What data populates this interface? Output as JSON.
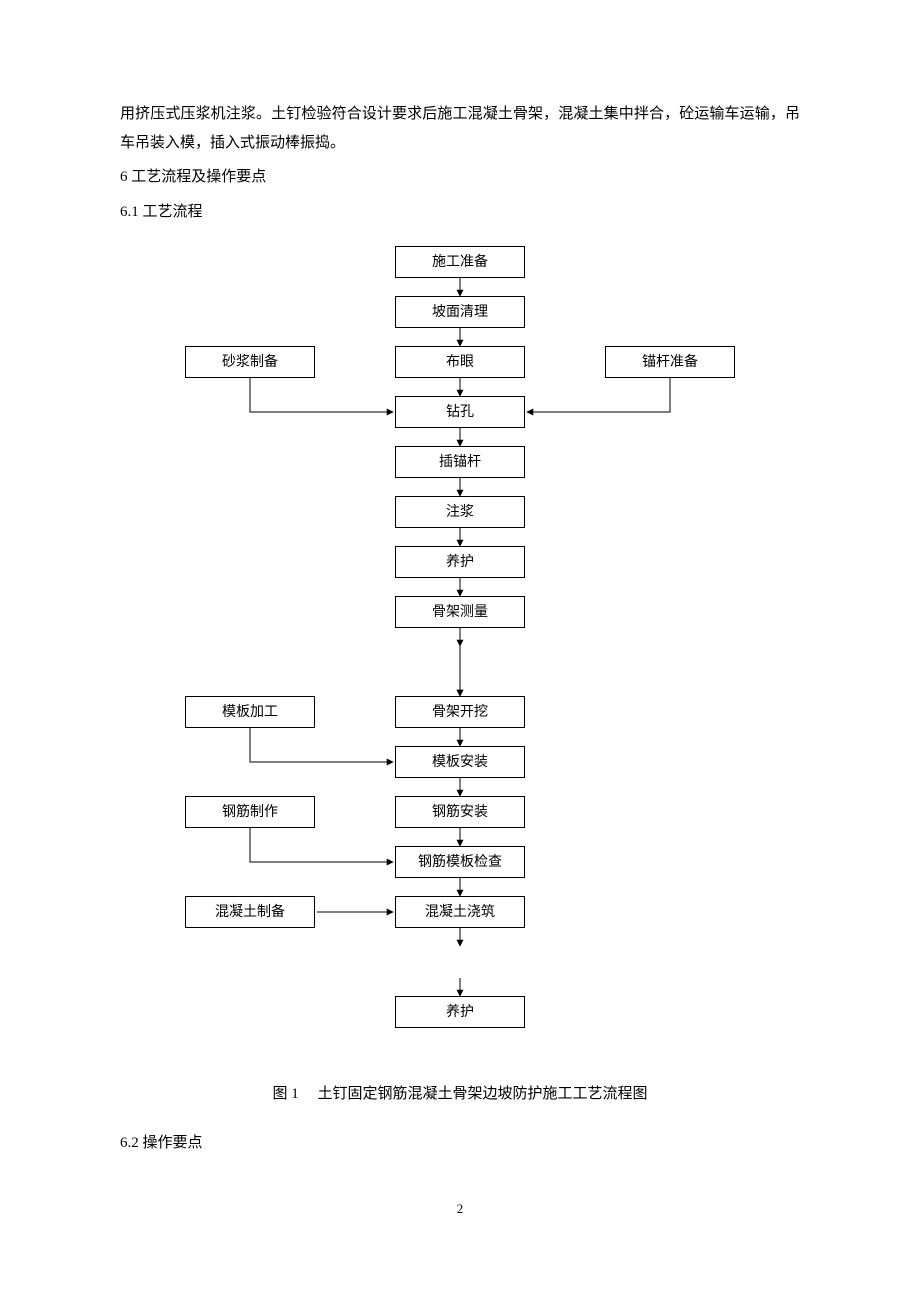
{
  "paragraph": "用挤压式压浆机注浆。土钉检验符合设计要求后施工混凝土骨架，混凝土集中拌合，砼运输车运输，吊车吊装入模，插入式振动棒振捣。",
  "headings": {
    "h6": "6 工艺流程及操作要点",
    "h6_1": "6.1 工艺流程",
    "h6_2": "6.2 操作要点"
  },
  "caption_label": "图 1",
  "caption_title": "土钉固定钢筋混凝土骨架边坡防护施工工艺流程图",
  "page_number": "2",
  "nodes": {
    "n1": "施工准备",
    "n2": "坡面清理",
    "n3": "布眼",
    "n3L": "砂浆制备",
    "n3R": "锚杆准备",
    "n4": "钻孔",
    "n5": "插锚杆",
    "n6": "注浆",
    "n7": "养护",
    "n8": "骨架测量",
    "n9": "骨架开挖",
    "n9L": "模板加工",
    "n10": "模板安装",
    "n11": "钢筋安装",
    "n11L": "钢筋制作",
    "n12": "钢筋模板检查",
    "n13": "混凝土浇筑",
    "n13L": "混凝土制备",
    "n14": "养护"
  },
  "chart_data": {
    "type": "flowchart",
    "direction": "top-down",
    "title": "土钉固定钢筋混凝土骨架边坡防护施工工艺流程图",
    "nodes": [
      {
        "id": "n1",
        "label": "施工准备"
      },
      {
        "id": "n2",
        "label": "坡面清理"
      },
      {
        "id": "n3L",
        "label": "砂浆制备"
      },
      {
        "id": "n3",
        "label": "布眼"
      },
      {
        "id": "n3R",
        "label": "锚杆准备"
      },
      {
        "id": "n4",
        "label": "钻孔"
      },
      {
        "id": "n5",
        "label": "插锚杆"
      },
      {
        "id": "n6",
        "label": "注浆"
      },
      {
        "id": "n7",
        "label": "养护"
      },
      {
        "id": "n8",
        "label": "骨架测量"
      },
      {
        "id": "n9L",
        "label": "模板加工"
      },
      {
        "id": "n9",
        "label": "骨架开挖"
      },
      {
        "id": "n10",
        "label": "模板安装"
      },
      {
        "id": "n11L",
        "label": "钢筋制作"
      },
      {
        "id": "n11",
        "label": "钢筋安装"
      },
      {
        "id": "n12",
        "label": "钢筋模板检查"
      },
      {
        "id": "n13L",
        "label": "混凝土制备"
      },
      {
        "id": "n13",
        "label": "混凝土浇筑"
      },
      {
        "id": "n14",
        "label": "养护"
      }
    ],
    "edges": [
      {
        "from": "n1",
        "to": "n2"
      },
      {
        "from": "n2",
        "to": "n3"
      },
      {
        "from": "n3",
        "to": "n4"
      },
      {
        "from": "n3L",
        "to": "n4"
      },
      {
        "from": "n3R",
        "to": "n4"
      },
      {
        "from": "n4",
        "to": "n5"
      },
      {
        "from": "n5",
        "to": "n6"
      },
      {
        "from": "n6",
        "to": "n7"
      },
      {
        "from": "n7",
        "to": "n8"
      },
      {
        "from": "n8",
        "to": "n9"
      },
      {
        "from": "n9",
        "to": "n10"
      },
      {
        "from": "n9L",
        "to": "n10"
      },
      {
        "from": "n10",
        "to": "n11"
      },
      {
        "from": "n11",
        "to": "n12"
      },
      {
        "from": "n11L",
        "to": "n12"
      },
      {
        "from": "n12",
        "to": "n13"
      },
      {
        "from": "n13L",
        "to": "n13"
      },
      {
        "from": "n13",
        "to": "n14"
      }
    ]
  }
}
